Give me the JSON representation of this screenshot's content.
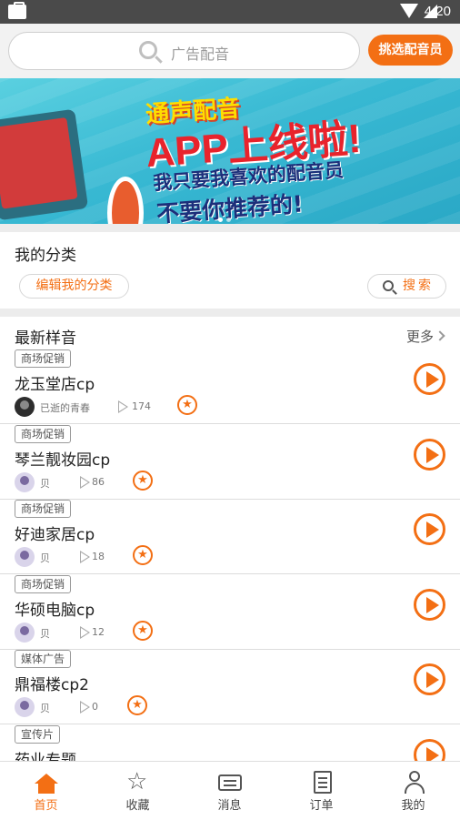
{
  "status_bar": {
    "time": "4:20"
  },
  "header": {
    "search_placeholder": "广告配音",
    "pick_button": "挑选配音员"
  },
  "banner": {
    "line1": "通声配音",
    "line2": "APP上线啦!",
    "line3": "我只要我喜欢的配音员",
    "line4": "不要你推荐的!"
  },
  "category": {
    "title": "我的分类",
    "edit_button": "编辑我的分类",
    "search_button": "搜索"
  },
  "latest": {
    "title": "最新样音",
    "more": "更多",
    "items": [
      {
        "tag": "商场促销",
        "name": "龙玉堂店cp",
        "author": "已逝的青春",
        "plays": "174"
      },
      {
        "tag": "商场促销",
        "name": "琴兰靓妆园cp",
        "author": "贝",
        "plays": "86"
      },
      {
        "tag": "商场促销",
        "name": "好迪家居cp",
        "author": "贝",
        "plays": "18"
      },
      {
        "tag": "商场促销",
        "name": "华硕电脑cp",
        "author": "贝",
        "plays": "12"
      },
      {
        "tag": "媒体广告",
        "name": "鼎福楼cp2",
        "author": "贝",
        "plays": "0"
      },
      {
        "tag": "宣传片",
        "name": "药业专题",
        "author": "",
        "plays": ""
      }
    ]
  },
  "bottom_nav": [
    {
      "label": "首页",
      "icon": "home-icon",
      "active": true
    },
    {
      "label": "收藏",
      "icon": "star-icon"
    },
    {
      "label": "消息",
      "icon": "message-icon"
    },
    {
      "label": "订单",
      "icon": "order-icon"
    },
    {
      "label": "我的",
      "icon": "user-icon"
    }
  ],
  "colors": {
    "accent": "#f36f14",
    "status_bar": "#4a4a4a",
    "banner_bg": "#38b9d3"
  }
}
